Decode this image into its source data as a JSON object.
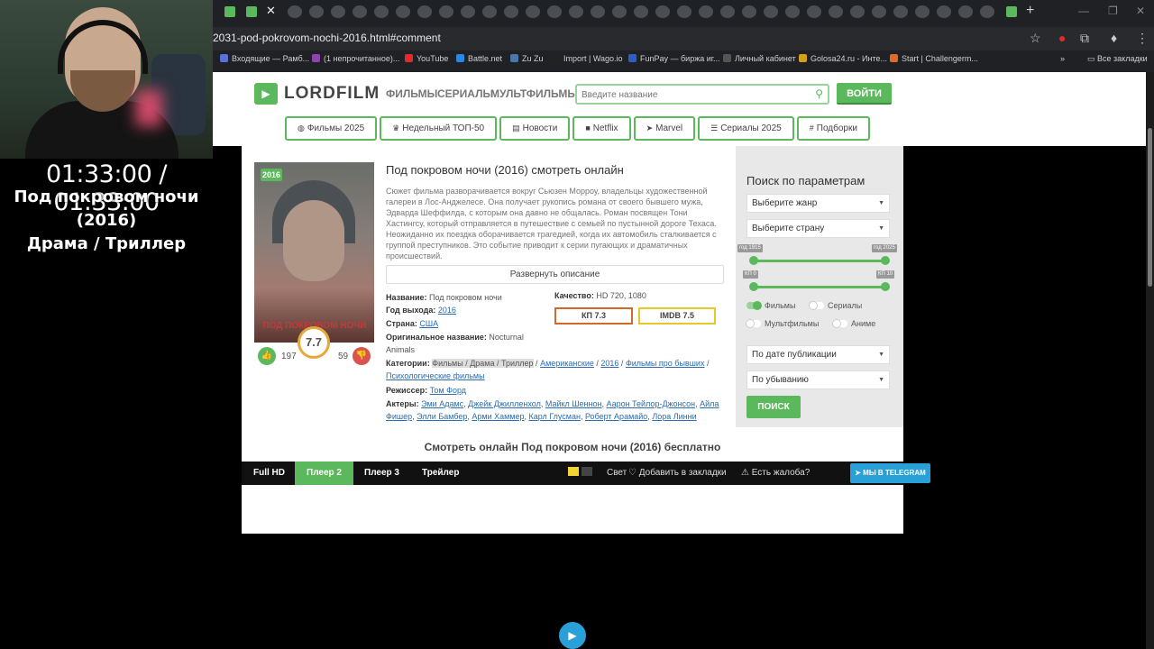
{
  "stream": {
    "timer": "01:33:00 / 01:33:00",
    "title_line1": "Под покровом ночи (2016)",
    "title_line2": "Драма / Триллер"
  },
  "browser": {
    "url": "2031-pod-pokrovom-nochi-2016.html#comment",
    "bookmarks": [
      {
        "label": "Входящие — Рамб...",
        "color": "#5a6fd8"
      },
      {
        "label": "(1 непрочитанное)...",
        "color": "#8e44ad"
      },
      {
        "label": "YouTube",
        "color": "#e02b2b"
      },
      {
        "label": "Battle.net",
        "color": "#2a88e0"
      },
      {
        "label": "Zu Zu",
        "color": "#4a76a8"
      },
      {
        "label": "Import | Wago.io",
        "color": "#222222"
      },
      {
        "label": "FunPay — биржа иг...",
        "color": "#2c5ec6"
      },
      {
        "label": "Личный кабинет",
        "color": "#555555"
      },
      {
        "label": "Golosa24.ru - Инте...",
        "color": "#d4a017"
      },
      {
        "label": "Start | Challengerm...",
        "color": "#e06a2a"
      }
    ],
    "all_bookmarks": "Все закладки"
  },
  "site": {
    "logo": "LORDFILM",
    "nav": [
      "ФИЛЬМЫ",
      "СЕРИАЛЫ",
      "МУЛЬТФИЛЬМЫ"
    ],
    "search_placeholder": "Введите название",
    "login": "ВОЙТИ",
    "categories": [
      {
        "icon": "◍",
        "label": "Фильмы 2025"
      },
      {
        "icon": "♛",
        "label": "Недельный ТОП-50"
      },
      {
        "icon": "▤",
        "label": "Новости"
      },
      {
        "icon": "■",
        "label": "Netflix"
      },
      {
        "icon": "➤",
        "label": "Marvel"
      },
      {
        "icon": "☰",
        "label": "Сериалы 2025"
      },
      {
        "icon": "#",
        "label": "Подборки"
      }
    ]
  },
  "movie": {
    "year_badge": "2016",
    "poster_text": "ПОД ПОКРОВОМ НОЧИ",
    "rating": "7.7",
    "likes": "197",
    "dislikes": "59",
    "title": "Под покровом ночи (2016) смотреть онлайн",
    "description": "Сюжет фильма разворачивается вокруг Сьюзен Морроу, владельцы художественной галереи в Лос-Анджелесе. Она получает рукопись романа от своего бывшего мужа, Эдварда Шеффилда, с которым она давно не общалась. Роман посвящен Тони Хастингсу, который отправляется в путешествие с семьей по пустынной дороге Техаса. Неожиданно их поездка оборачивается трагедией, когда их автомобиль сталкивается с группой преступников. Это событие приводит к серии пугающих и драматичных происшествий.",
    "expand": "Развернуть описание",
    "name_label": "Название:",
    "name_value": "Под покровом ночи",
    "year_label": "Год выхода:",
    "year_value": "2016",
    "country_label": "Страна:",
    "country_value": "США",
    "orig_label": "Оригинальное название:",
    "orig_value": "Nocturnal Animals",
    "quality_label": "Качество:",
    "quality_value": "HD 720, 1080",
    "kp": "КП 7.3",
    "imdb": "IMDB 7.5",
    "cat_label": "Категории:",
    "cat_highlight": "Фильмы / Драма / Триллер",
    "cat_rest": [
      "Американские",
      "2016",
      "Фильмы про бывших",
      "Психологические фильмы"
    ],
    "director_label": "Режиссер:",
    "director_value": "Том Форд",
    "actors_label": "Актеры:",
    "actors": [
      "Эми Адамс",
      "Джейк Джилленхол",
      "Майкл Шеннон",
      "Аарон Тейлор-Джонсон",
      "Айла Фишер",
      "Элли Бамбер",
      "Арми Хаммер",
      "Карл Глусман",
      "Роберт Арамайо",
      "Лора Линни"
    ],
    "watch_title": "Смотреть онлайн Под покровом ночи (2016) бесплатно"
  },
  "filter": {
    "title": "Поиск по параметрам",
    "genre": "Выберите жанр",
    "country": "Выберите страну",
    "year_from": "год 1915",
    "year_to": "год 2025",
    "kp_from": "КП 0",
    "kp_to": "КП 10",
    "toggles": [
      {
        "label": "Фильмы",
        "on": true
      },
      {
        "label": "Сериалы",
        "on": false
      },
      {
        "label": "Мультфильмы",
        "on": false
      },
      {
        "label": "Аниме",
        "on": false
      }
    ],
    "sort": "По дате публикации",
    "order": "По убыванию",
    "button": "ПОИСК"
  },
  "player": {
    "tabs": [
      "Full HD",
      "Плеер 2",
      "Плеер 3",
      "Трейлер"
    ],
    "active_tab": "Плеер 2",
    "light": "Свет",
    "bookmark": "Добавить в закладки",
    "complaint": "Есть жалоба?",
    "telegram": "МЫ В TELEGRAM"
  }
}
